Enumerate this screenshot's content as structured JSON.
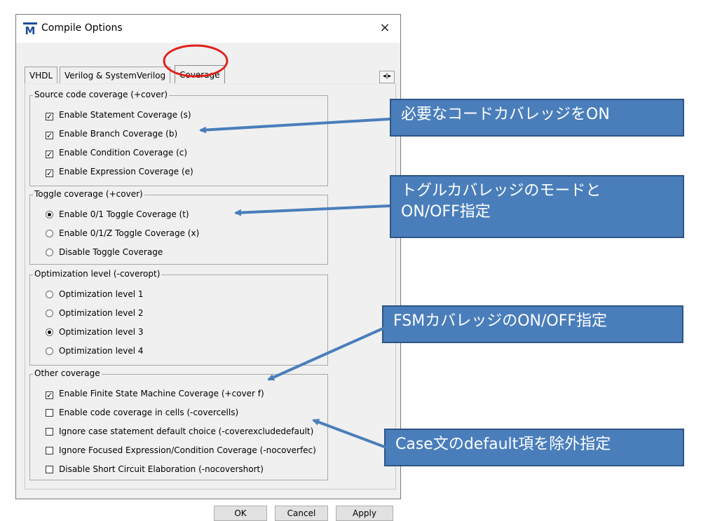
{
  "window": {
    "title": "Compile Options",
    "icon": "modelsim-m-icon",
    "close_label": "×"
  },
  "tabs": [
    {
      "label": "VHDL",
      "active": false
    },
    {
      "label": "Verilog & SystemVerilog",
      "active": false
    },
    {
      "label": "Coverage",
      "active": true
    }
  ],
  "tab_scroll_label": "◂|▸",
  "groups": {
    "source": {
      "label": "Source code coverage (+cover)",
      "items": [
        {
          "label": "Enable Statement Coverage (s)",
          "checked": true
        },
        {
          "label": "Enable Branch Coverage (b)",
          "checked": true
        },
        {
          "label": "Enable Condition Coverage (c)",
          "checked": true
        },
        {
          "label": "Enable Expression Coverage (e)",
          "checked": true
        }
      ]
    },
    "toggle": {
      "label": "Toggle coverage (+cover)",
      "items": [
        {
          "label": "Enable 0/1 Toggle Coverage (t)",
          "selected": true
        },
        {
          "label": "Enable 0/1/Z Toggle Coverage (x)",
          "selected": false
        },
        {
          "label": "Disable Toggle Coverage",
          "selected": false
        }
      ]
    },
    "optimization": {
      "label": "Optimization level (-coveropt)",
      "items": [
        {
          "label": "Optimization level 1",
          "selected": false
        },
        {
          "label": "Optimization level 2",
          "selected": false
        },
        {
          "label": "Optimization level 3",
          "selected": true
        },
        {
          "label": "Optimization level 4",
          "selected": false
        }
      ]
    },
    "other": {
      "label": "Other coverage",
      "items": [
        {
          "label": "Enable Finite State Machine Coverage (+cover f)",
          "checked": true
        },
        {
          "label": "Enable code coverage in cells (-covercells)",
          "checked": false
        },
        {
          "label": "Ignore case statement default choice (-coverexcludedefault)",
          "checked": false
        },
        {
          "label": "Ignore Focused Expression/Condition Coverage (-nocoverfec)",
          "checked": false
        },
        {
          "label": "Disable Short Circuit Elaboration (-nocovershort)",
          "checked": false
        }
      ]
    }
  },
  "buttons": {
    "ok": "OK",
    "cancel": "Cancel",
    "apply": "Apply"
  },
  "callouts": {
    "source": "必要なコードカバレッジをON",
    "toggle_line1": "トグルカバレッジのモードと",
    "toggle_line2": "ON/OFF指定",
    "fsm": "FSMカバレッジのON/OFF指定",
    "case": "Case文のdefault項を除外指定"
  },
  "colors": {
    "callout_fill": "#4a7ebb",
    "callout_border": "#2e5584",
    "highlight_ellipse": "#e0201b"
  }
}
